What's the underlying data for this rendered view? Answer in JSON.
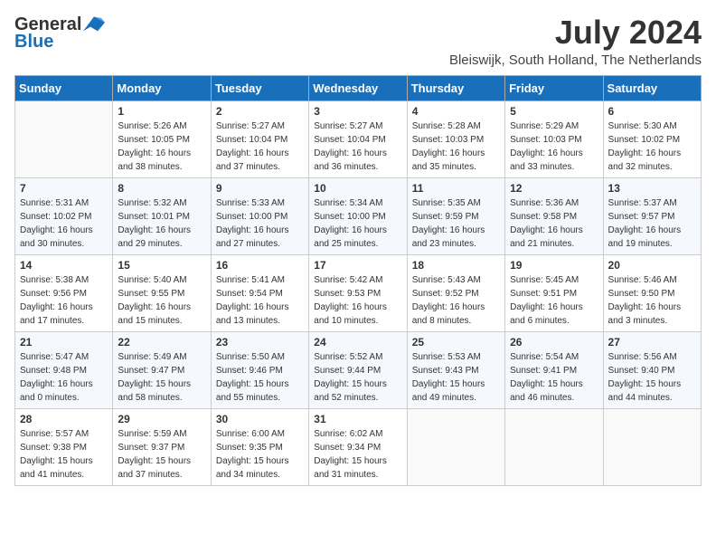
{
  "header": {
    "logo_general": "General",
    "logo_blue": "Blue",
    "month_title": "July 2024",
    "location": "Bleiswijk, South Holland, The Netherlands"
  },
  "days_of_week": [
    "Sunday",
    "Monday",
    "Tuesday",
    "Wednesday",
    "Thursday",
    "Friday",
    "Saturday"
  ],
  "weeks": [
    [
      {
        "day": "",
        "sunrise": "",
        "sunset": "",
        "daylight": ""
      },
      {
        "day": "1",
        "sunrise": "Sunrise: 5:26 AM",
        "sunset": "Sunset: 10:05 PM",
        "daylight": "Daylight: 16 hours and 38 minutes."
      },
      {
        "day": "2",
        "sunrise": "Sunrise: 5:27 AM",
        "sunset": "Sunset: 10:04 PM",
        "daylight": "Daylight: 16 hours and 37 minutes."
      },
      {
        "day": "3",
        "sunrise": "Sunrise: 5:27 AM",
        "sunset": "Sunset: 10:04 PM",
        "daylight": "Daylight: 16 hours and 36 minutes."
      },
      {
        "day": "4",
        "sunrise": "Sunrise: 5:28 AM",
        "sunset": "Sunset: 10:03 PM",
        "daylight": "Daylight: 16 hours and 35 minutes."
      },
      {
        "day": "5",
        "sunrise": "Sunrise: 5:29 AM",
        "sunset": "Sunset: 10:03 PM",
        "daylight": "Daylight: 16 hours and 33 minutes."
      },
      {
        "day": "6",
        "sunrise": "Sunrise: 5:30 AM",
        "sunset": "Sunset: 10:02 PM",
        "daylight": "Daylight: 16 hours and 32 minutes."
      }
    ],
    [
      {
        "day": "7",
        "sunrise": "Sunrise: 5:31 AM",
        "sunset": "Sunset: 10:02 PM",
        "daylight": "Daylight: 16 hours and 30 minutes."
      },
      {
        "day": "8",
        "sunrise": "Sunrise: 5:32 AM",
        "sunset": "Sunset: 10:01 PM",
        "daylight": "Daylight: 16 hours and 29 minutes."
      },
      {
        "day": "9",
        "sunrise": "Sunrise: 5:33 AM",
        "sunset": "Sunset: 10:00 PM",
        "daylight": "Daylight: 16 hours and 27 minutes."
      },
      {
        "day": "10",
        "sunrise": "Sunrise: 5:34 AM",
        "sunset": "Sunset: 10:00 PM",
        "daylight": "Daylight: 16 hours and 25 minutes."
      },
      {
        "day": "11",
        "sunrise": "Sunrise: 5:35 AM",
        "sunset": "Sunset: 9:59 PM",
        "daylight": "Daylight: 16 hours and 23 minutes."
      },
      {
        "day": "12",
        "sunrise": "Sunrise: 5:36 AM",
        "sunset": "Sunset: 9:58 PM",
        "daylight": "Daylight: 16 hours and 21 minutes."
      },
      {
        "day": "13",
        "sunrise": "Sunrise: 5:37 AM",
        "sunset": "Sunset: 9:57 PM",
        "daylight": "Daylight: 16 hours and 19 minutes."
      }
    ],
    [
      {
        "day": "14",
        "sunrise": "Sunrise: 5:38 AM",
        "sunset": "Sunset: 9:56 PM",
        "daylight": "Daylight: 16 hours and 17 minutes."
      },
      {
        "day": "15",
        "sunrise": "Sunrise: 5:40 AM",
        "sunset": "Sunset: 9:55 PM",
        "daylight": "Daylight: 16 hours and 15 minutes."
      },
      {
        "day": "16",
        "sunrise": "Sunrise: 5:41 AM",
        "sunset": "Sunset: 9:54 PM",
        "daylight": "Daylight: 16 hours and 13 minutes."
      },
      {
        "day": "17",
        "sunrise": "Sunrise: 5:42 AM",
        "sunset": "Sunset: 9:53 PM",
        "daylight": "Daylight: 16 hours and 10 minutes."
      },
      {
        "day": "18",
        "sunrise": "Sunrise: 5:43 AM",
        "sunset": "Sunset: 9:52 PM",
        "daylight": "Daylight: 16 hours and 8 minutes."
      },
      {
        "day": "19",
        "sunrise": "Sunrise: 5:45 AM",
        "sunset": "Sunset: 9:51 PM",
        "daylight": "Daylight: 16 hours and 6 minutes."
      },
      {
        "day": "20",
        "sunrise": "Sunrise: 5:46 AM",
        "sunset": "Sunset: 9:50 PM",
        "daylight": "Daylight: 16 hours and 3 minutes."
      }
    ],
    [
      {
        "day": "21",
        "sunrise": "Sunrise: 5:47 AM",
        "sunset": "Sunset: 9:48 PM",
        "daylight": "Daylight: 16 hours and 0 minutes."
      },
      {
        "day": "22",
        "sunrise": "Sunrise: 5:49 AM",
        "sunset": "Sunset: 9:47 PM",
        "daylight": "Daylight: 15 hours and 58 minutes."
      },
      {
        "day": "23",
        "sunrise": "Sunrise: 5:50 AM",
        "sunset": "Sunset: 9:46 PM",
        "daylight": "Daylight: 15 hours and 55 minutes."
      },
      {
        "day": "24",
        "sunrise": "Sunrise: 5:52 AM",
        "sunset": "Sunset: 9:44 PM",
        "daylight": "Daylight: 15 hours and 52 minutes."
      },
      {
        "day": "25",
        "sunrise": "Sunrise: 5:53 AM",
        "sunset": "Sunset: 9:43 PM",
        "daylight": "Daylight: 15 hours and 49 minutes."
      },
      {
        "day": "26",
        "sunrise": "Sunrise: 5:54 AM",
        "sunset": "Sunset: 9:41 PM",
        "daylight": "Daylight: 15 hours and 46 minutes."
      },
      {
        "day": "27",
        "sunrise": "Sunrise: 5:56 AM",
        "sunset": "Sunset: 9:40 PM",
        "daylight": "Daylight: 15 hours and 44 minutes."
      }
    ],
    [
      {
        "day": "28",
        "sunrise": "Sunrise: 5:57 AM",
        "sunset": "Sunset: 9:38 PM",
        "daylight": "Daylight: 15 hours and 41 minutes."
      },
      {
        "day": "29",
        "sunrise": "Sunrise: 5:59 AM",
        "sunset": "Sunset: 9:37 PM",
        "daylight": "Daylight: 15 hours and 37 minutes."
      },
      {
        "day": "30",
        "sunrise": "Sunrise: 6:00 AM",
        "sunset": "Sunset: 9:35 PM",
        "daylight": "Daylight: 15 hours and 34 minutes."
      },
      {
        "day": "31",
        "sunrise": "Sunrise: 6:02 AM",
        "sunset": "Sunset: 9:34 PM",
        "daylight": "Daylight: 15 hours and 31 minutes."
      },
      {
        "day": "",
        "sunrise": "",
        "sunset": "",
        "daylight": ""
      },
      {
        "day": "",
        "sunrise": "",
        "sunset": "",
        "daylight": ""
      },
      {
        "day": "",
        "sunrise": "",
        "sunset": "",
        "daylight": ""
      }
    ]
  ]
}
